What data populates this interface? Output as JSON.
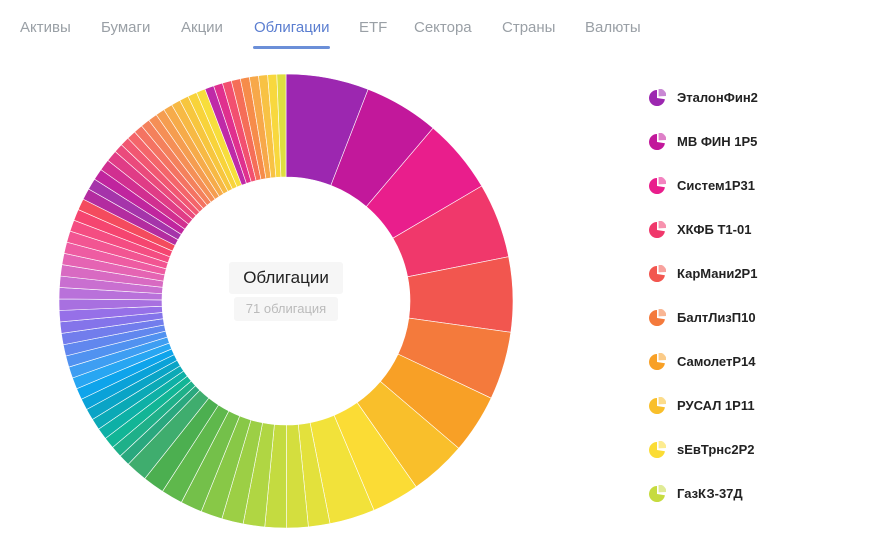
{
  "tabs": [
    {
      "label": "Активы",
      "active": false
    },
    {
      "label": "Бумаги",
      "active": false
    },
    {
      "label": "Акции",
      "active": false
    },
    {
      "label": "Облигации",
      "active": true
    },
    {
      "label": "ETF",
      "active": false
    },
    {
      "label": "Сектора",
      "active": false
    },
    {
      "label": "Страны",
      "active": false
    },
    {
      "label": "Валюты",
      "active": false
    }
  ],
  "center": {
    "title": "Облигации",
    "subtitle": "71 облигация"
  },
  "chart_data": {
    "type": "pie",
    "subtype": "donut",
    "title": "Облигации",
    "subtitle": "71 облигация",
    "legend_position": "right",
    "series": [
      {
        "values": [
          7.3,
          6.6,
          6.6,
          6.6,
          6.6,
          6.0,
          5.2,
          5.0,
          4.2,
          4.0,
          1.9,
          1.9,
          1.9,
          1.9,
          1.9,
          1.9,
          1.9,
          1.9,
          1.9,
          1.9,
          1.0,
          1.0,
          1.0,
          1.0,
          1.0,
          1.0,
          1.0,
          1.0,
          1.0,
          1.0,
          1.0,
          1.0,
          1.0,
          1.0,
          1.0,
          1.0,
          1.0,
          1.0,
          1.0,
          1.0,
          1.0,
          1.0,
          1.0,
          1.0,
          1.0,
          1.0,
          1.0,
          1.0,
          1.0,
          1.0,
          0.8,
          0.8,
          0.8,
          0.8,
          0.8,
          0.8,
          0.8,
          0.8,
          0.8,
          0.8,
          0.8,
          0.8,
          0.8,
          0.8,
          0.8,
          0.8,
          0.8,
          0.8,
          0.8,
          0.8,
          0.8
        ],
        "colors": [
          "#9c27b0",
          "#c2189b",
          "#e91e8c",
          "#f0386b",
          "#f2564f",
          "#f47a3c",
          "#f8a026",
          "#f9bf2b",
          "#fbdc35",
          "#f2e23a",
          "#e3e13c",
          "#d4de3e",
          "#c4db40",
          "#b0d643",
          "#9ccf45",
          "#88c847",
          "#74c04a",
          "#5fb84c",
          "#4caf50",
          "#3fad6e",
          "#2aa87e",
          "#1fb089",
          "#12b596",
          "#0eb0a6",
          "#0ba9b6",
          "#0aa4c6",
          "#0aa2d8",
          "#0ea4eb",
          "#28a6f2",
          "#3e9ef2",
          "#5192f0",
          "#6187ee",
          "#727dec",
          "#8474ea",
          "#9670e8",
          "#a870e0",
          "#b971da",
          "#c96fd0",
          "#d86ac2",
          "#e564b3",
          "#ee5ca2",
          "#f25592",
          "#f44d82",
          "#f54570",
          "#f44b5e",
          "#b32ca0",
          "#a534aa",
          "#c0259e",
          "#d12f90",
          "#e03c86",
          "#ea4a7c",
          "#f15772",
          "#f4656a",
          "#f47362",
          "#f4815c",
          "#f58f56",
          "#f59d50",
          "#f6ab4a",
          "#f7b944",
          "#f7c63e",
          "#f8d33a",
          "#f7de3c",
          "#bf2aa8",
          "#e0308e",
          "#f25070",
          "#f56e58",
          "#f68c4a",
          "#f7a84a",
          "#f8c244",
          "#f8d83e",
          "#dede40"
        ]
      }
    ],
    "legend": [
      {
        "label": "ЭталонФин2",
        "color": "#9c27b0"
      },
      {
        "label": "МВ ФИН 1Р5",
        "color": "#c2189b"
      },
      {
        "label": "Систем1Р31",
        "color": "#e91e8c"
      },
      {
        "label": "ХКФБ Т1-01",
        "color": "#f0386b"
      },
      {
        "label": "КарМани2Р1",
        "color": "#f2564f"
      },
      {
        "label": "БалтЛизП10",
        "color": "#f47a3c"
      },
      {
        "label": "СамолетР14",
        "color": "#f8a026"
      },
      {
        "label": "РУСАЛ 1Р11",
        "color": "#f9bf2b"
      },
      {
        "label": "sЕвТрнс2Р2",
        "color": "#fbdc35"
      },
      {
        "label": "ГазКЗ-37Д",
        "color": "#c6db3f"
      }
    ]
  }
}
